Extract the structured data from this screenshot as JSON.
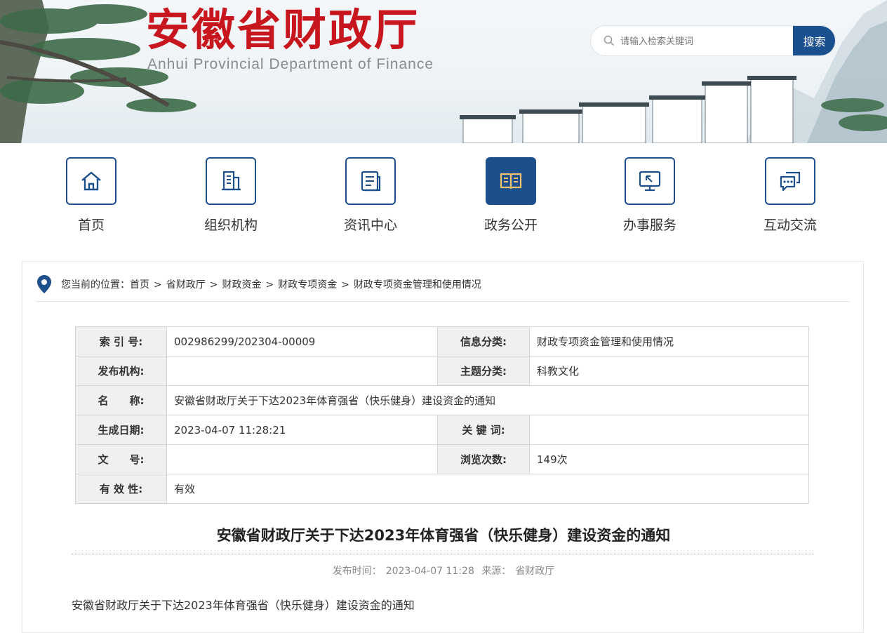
{
  "header": {
    "title": "安徽省财政厅",
    "subtitle": "Anhui Provincial Department of Finance",
    "search": {
      "placeholder": "请输入检索关键词",
      "button_label": "搜索"
    }
  },
  "nav": {
    "items": [
      {
        "label": "首页",
        "icon": "home-icon"
      },
      {
        "label": "组织机构",
        "icon": "building-icon"
      },
      {
        "label": "资讯中心",
        "icon": "document-icon"
      },
      {
        "label": "政务公开",
        "icon": "book-icon",
        "active": true
      },
      {
        "label": "办事服务",
        "icon": "monitor-icon"
      },
      {
        "label": "互动交流",
        "icon": "chat-icon"
      }
    ]
  },
  "breadcrumb": {
    "prefix": "您当前的位置：",
    "items": [
      "首页",
      "省财政厅",
      "财政资金",
      "财政专项资金",
      "财政专项资金管理和使用情况"
    ]
  },
  "info": {
    "index_label": "索 引 号:",
    "index_value": "002986299/202304-00009",
    "category_label": "信息分类:",
    "category_value": "财政专项资金管理和使用情况",
    "publisher_label": "发布机构:",
    "publisher_value": "",
    "topic_label": "主题分类:",
    "topic_value": "科教文化",
    "name_label": "名　　称:",
    "name_value": "安徽省财政厅关于下达2023年体育强省（快乐健身）建设资金的通知",
    "date_label": "生成日期:",
    "date_value": "2023-04-07 11:28:21",
    "keywords_label": "关 键 词:",
    "keywords_value": "",
    "docno_label": "文　　号:",
    "docno_value": "",
    "views_label": "浏览次数:",
    "views_value": "149次",
    "validity_label": "有 效 性:",
    "validity_value": "有效"
  },
  "article": {
    "title": "安徽省财政厅关于下达2023年体育强省（快乐健身）建设资金的通知",
    "published_label": "发布时间：",
    "published_value": "2023-04-07 11:28",
    "source_label": "来源：",
    "source_value": "省财政厅",
    "body_first_line": "安徽省财政厅关于下达2023年体育强省（快乐健身）建设资金的通知"
  },
  "colors": {
    "brand_red": "#c8161e",
    "nav_blue": "#1d4f8b",
    "search_blue": "#1a4f90"
  }
}
